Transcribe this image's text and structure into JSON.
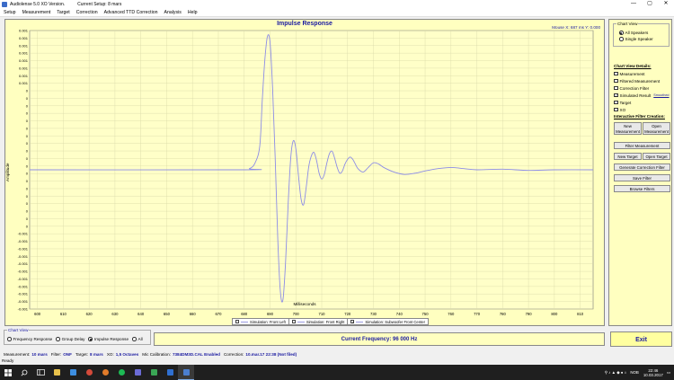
{
  "window": {
    "title": "Audiolense 5.0 XO Version.",
    "setup": "Current Setup: 8 mars",
    "controls": [
      "—",
      "▢",
      "✕"
    ]
  },
  "menu": [
    "Setup",
    "Measurement",
    "Target",
    "Correction",
    "Advanced TTD Correction",
    "Analysis",
    "Help"
  ],
  "chart": {
    "title": "Impulse Response",
    "mouse_readout": "Mouse X: 687 ms  Y: 0.000",
    "ylabel": "Amplitude",
    "xlabel": "Milliseconds",
    "y_ticks": [
      "0.001",
      "0.001",
      "0.001",
      "0.001",
      "0.001",
      "0.001",
      "0.001",
      "0.001",
      "0",
      "0",
      "0",
      "0",
      "0",
      "0",
      "0",
      "0",
      "0",
      "0",
      "0",
      "0",
      "0",
      "0",
      "0",
      "0",
      "0",
      "0",
      "0",
      "-0.001",
      "-0.001",
      "-0.001",
      "-0.001",
      "-0.001",
      "-0.001",
      "-0.001",
      "-0.001",
      "-0.001",
      "-0.001",
      "-0.001"
    ],
    "x_ticks": [
      "600",
      "610",
      "620",
      "630",
      "640",
      "650",
      "660",
      "670",
      "680",
      "690",
      "700",
      "710",
      "720",
      "730",
      "740",
      "750",
      "760",
      "770",
      "780",
      "790",
      "800",
      "810"
    ],
    "legend": [
      {
        "label": "Simulation: Front Left",
        "checked": false
      },
      {
        "label": "Simulation: Front Right",
        "checked": false
      },
      {
        "label": "Simulation: Subwoofer Front Center",
        "checked": true
      }
    ],
    "line_color": "#8c8ce6"
  },
  "chart_data": {
    "type": "line",
    "title": "Impulse Response",
    "xlabel": "Milliseconds",
    "ylabel": "Amplitude",
    "xlim": [
      597,
      815
    ],
    "ylim": [
      -0.0012,
      0.0012
    ],
    "grid": true,
    "legend_position": "bottom-center",
    "series": [
      {
        "name": "Simulation: Subwoofer Front Center",
        "x": [
          597,
          680,
          682,
          684,
          686,
          687,
          688,
          689,
          690,
          691,
          692,
          693,
          694,
          695,
          696,
          697,
          698,
          699,
          700,
          701,
          702,
          703,
          704,
          705,
          706,
          707,
          708,
          709,
          710,
          711,
          712,
          713,
          714,
          715,
          716,
          717,
          718,
          719,
          720,
          721,
          722,
          723,
          724,
          726,
          728,
          730,
          732,
          734,
          738,
          742,
          746,
          750,
          755,
          760,
          765,
          770,
          780,
          790,
          800,
          815
        ],
        "y": [
          0,
          0,
          1e-05,
          5e-05,
          0.0002,
          0.0006,
          0.00095,
          0.00115,
          0.0011,
          0.0007,
          0.0001,
          -0.0006,
          -0.00105,
          -0.00112,
          -0.0008,
          -0.0003,
          0.0001,
          0.00025,
          0.00018,
          -5e-05,
          -0.00025,
          -0.0003,
          -0.00015,
          3e-05,
          0.00012,
          0.00015,
          8e-05,
          -3e-05,
          -8e-05,
          -4e-05,
          6e-05,
          0.00014,
          0.00016,
          0.0001,
          2e-05,
          -3e-05,
          -1e-05,
          5e-05,
          9e-05,
          0.00011,
          9e-05,
          5e-05,
          1e-05,
          -2e-05,
          2e-05,
          6e-05,
          5e-05,
          2e-05,
          -2e-05,
          -4e-05,
          -3e-05,
          -1e-05,
          1e-05,
          2e-05,
          1e-05,
          0,
          5e-06,
          -5e-06,
          0,
          0
        ]
      }
    ]
  },
  "side": {
    "chart_view_title": "Chart View",
    "radios": [
      {
        "label": "All Speakers",
        "on": true
      },
      {
        "label": "Single Speaker",
        "on": false
      }
    ],
    "details_title": "Chart View Details:",
    "details": [
      {
        "label": "Measurement",
        "checked": false
      },
      {
        "label": "Filtered Measurement",
        "checked": false
      },
      {
        "label": "Correction Filter",
        "checked": false
      },
      {
        "label": "Simulated Result",
        "checked": true
      },
      {
        "label": "Target",
        "checked": false
      },
      {
        "label": "XO",
        "checked": false
      }
    ],
    "smoothed": "Smoothed",
    "filter_creation_title": "Interactive Filter Creation:",
    "btn_new_measurement": "New Measurement",
    "btn_open_measurement": "Open Measurement",
    "btn_filter_measurement": "Filter Measurement",
    "btn_new_target": "New Target",
    "btn_open_target": "Open Target",
    "btn_generate": "Generate Correction Filter",
    "btn_save": "Save Filter",
    "btn_browse": "Browse Filters"
  },
  "bottom": {
    "chart_view_title": "Chart View",
    "options": [
      {
        "label": "Frequency Response",
        "on": false
      },
      {
        "label": "Group Delay",
        "on": false
      },
      {
        "label": "Impulse Response",
        "on": true
      },
      {
        "label": "All",
        "on": false
      }
    ],
    "current_frequency": "Current Frequency: 96 000 Hz",
    "exit": "Exit"
  },
  "status": {
    "measurement_label": "Measurement:",
    "measurement": "10 mars",
    "filter_label": "Filter:",
    "filter": "ONF",
    "target_label": "Target:",
    "target": "8 mars",
    "xo_label": "XO:",
    "xo": "1,5 Octaves",
    "mic_label": "Mic Calibration:",
    "mic": "7384DM3D.CAL Enabled",
    "correction_label": "Correction:",
    "correction": "10.mar.17 22:38 (Not filed)",
    "ready": "Ready"
  },
  "taskbar": {
    "lang": "NOB",
    "time": "22:46",
    "date": "10.03.2017"
  }
}
